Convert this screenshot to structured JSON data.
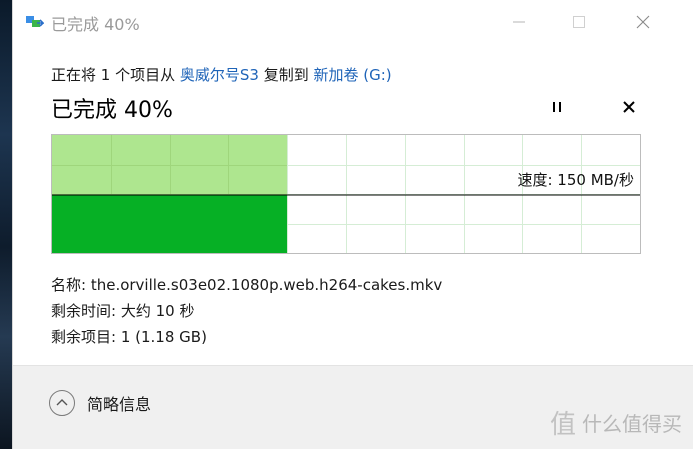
{
  "window": {
    "title": "已完成 40%"
  },
  "copy": {
    "prefix": "正在将 1 个项目从 ",
    "source": "奥威尔号S3",
    "middle": " 复制到 ",
    "destination": "新加卷 (G:)"
  },
  "progress": {
    "headline": "已完成 40%",
    "fraction": 0.4
  },
  "speed": {
    "label": "速度: 150 MB/秒"
  },
  "details": {
    "name": "名称: the.orville.s03e02.1080p.web.h264-cakes.mkv",
    "time_left": "剩余时间: 大约 10 秒",
    "items_left": "剩余项目: 1 (1.18 GB)"
  },
  "footer": {
    "less_details": "简略信息"
  },
  "watermark": {
    "text": "什么值得买"
  },
  "colors": {
    "accent_link": "#1f64b8",
    "progress_fill": "#06b025",
    "progress_light": "#aee68f",
    "grid": "#d5edd5"
  },
  "icons": {
    "title": "copy-app-icon",
    "pause": "pause-icon",
    "cancel": "close-icon",
    "less": "chevron-up-icon"
  }
}
